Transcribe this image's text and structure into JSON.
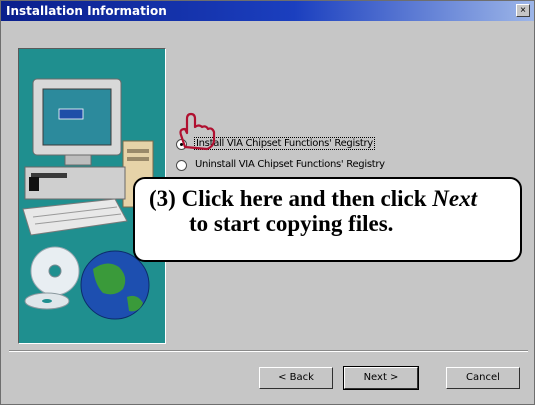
{
  "window": {
    "title": "Installation Information",
    "close_glyph": "×"
  },
  "options": [
    {
      "label": "Install VIA Chipset Functions' Registry",
      "selected": true
    },
    {
      "label": "Uninstall VIA Chipset Functions' Registry",
      "selected": false
    }
  ],
  "callout": {
    "step": "(3)",
    "text_before": "Click here and then click",
    "emphasis": "Next",
    "line2": "to start copying files."
  },
  "buttons": {
    "back": "< Back",
    "next": "Next >",
    "cancel": "Cancel"
  },
  "colors": {
    "title_bar_start": "#0a1f8c",
    "side_panel": "#1f8f8f",
    "window_bg": "#c6c6c6"
  },
  "icons": {
    "side_panel": "computer-with-cds-and-globe",
    "pointer": "hand-pointer-icon"
  }
}
